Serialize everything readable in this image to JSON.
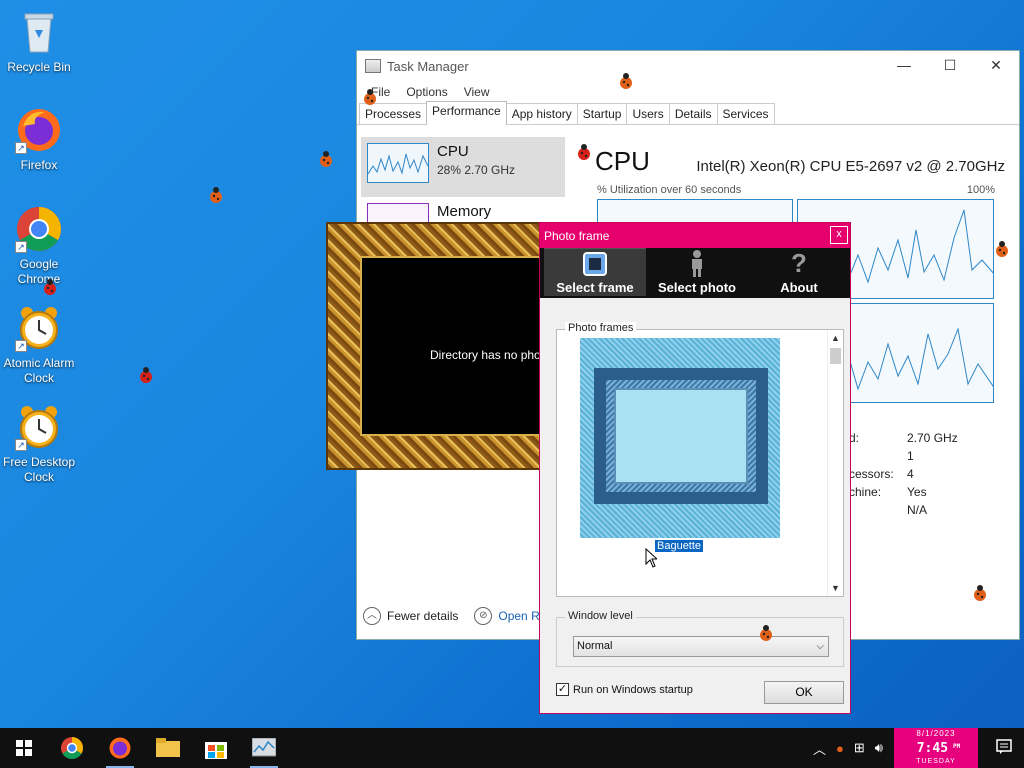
{
  "desktop": {
    "icons": [
      {
        "label": "Recycle Bin"
      },
      {
        "label": "Firefox"
      },
      {
        "label": "Google Chrome"
      },
      {
        "label": "Atomic Alarm Clock"
      },
      {
        "label": "Free Desktop Clock"
      }
    ]
  },
  "task_manager": {
    "title": "Task Manager",
    "menu": [
      "File",
      "Options",
      "View"
    ],
    "tabs": [
      "Processes",
      "Performance",
      "App history",
      "Startup",
      "Users",
      "Details",
      "Services"
    ],
    "active_tab": "Performance",
    "sidebar": [
      {
        "name": "CPU",
        "detail": "28%  2.70 GHz"
      },
      {
        "name": "Memory",
        "detail": ""
      }
    ],
    "cpu": {
      "title": "CPU",
      "model": "Intel(R) Xeon(R) CPU E5-2697 v2 @ 2.70GHz",
      "util_label": "% Utilization over 60 seconds",
      "util_max": "100%"
    },
    "stats": [
      {
        "k": "d:",
        "v": "2.70 GHz"
      },
      {
        "k": "",
        "v": "1"
      },
      {
        "k": "cessors:",
        "v": "4"
      },
      {
        "k": "chine:",
        "v": "Yes"
      },
      {
        "k": "",
        "v": "N/A"
      }
    ],
    "footer": {
      "fewer": "Fewer details",
      "open": "Open Re"
    }
  },
  "gold_frame": {
    "message": "Directory has no photos"
  },
  "photo_frame": {
    "title": "Photo frame",
    "toolbar": [
      "Select frame",
      "Select photo",
      "About"
    ],
    "frames_legend": "Photo frames",
    "frame_item": "Baguette",
    "window_level_legend": "Window level",
    "window_level_value": "Normal",
    "startup_label": "Run on Windows startup",
    "startup_checked": true,
    "ok_label": "OK"
  },
  "taskbar": {
    "clock": {
      "date": "8/1/2023",
      "time": "7:45",
      "ampm": "PM",
      "weekday": "TUESDAY"
    }
  }
}
